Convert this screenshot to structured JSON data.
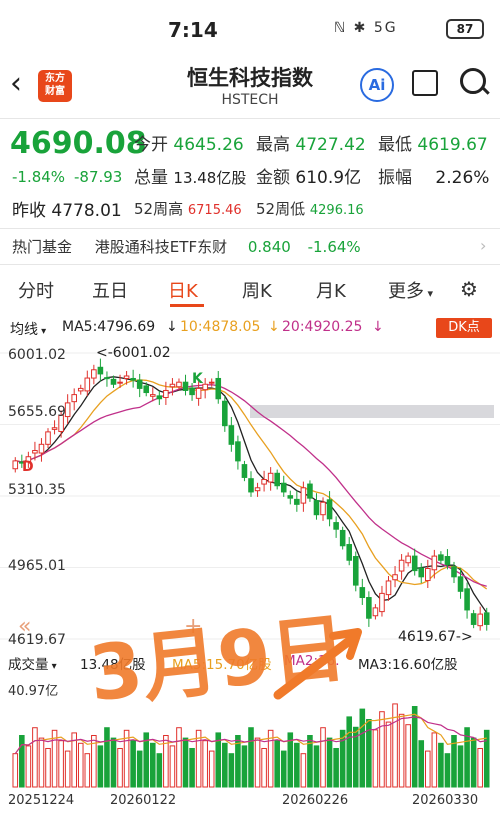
{
  "status_bar": {
    "time": "7:14",
    "battery": "87",
    "icons_text": "ℕ ✱ 5G"
  },
  "header": {
    "title": "恒生科技指数",
    "subtitle": "HSTECH",
    "logo_text": "东方\n财富",
    "ai_label": "Ai"
  },
  "quote": {
    "price": "4690.08",
    "change_pct": "-1.84%",
    "change_abs": "-87.93",
    "prev_close_label": "昨收",
    "prev_close": "4778.01",
    "open_label": "今开",
    "open": "4645.26",
    "high_label": "最高",
    "high": "4727.42",
    "low_label": "最低",
    "low": "4619.67",
    "volume_label": "总量",
    "volume": "13.48亿股",
    "amount_label": "金额",
    "amount": "610.9亿",
    "amplitude_label": "振幅",
    "amplitude": "2.26%",
    "wk52_high_label": "52周高",
    "wk52_high": "6715.46",
    "wk52_low_label": "52周低",
    "wk52_low": "4296.16"
  },
  "hot_fund": {
    "label": "热门基金",
    "name": "港股通科技ETF东财",
    "price": "0.840",
    "change": "-1.64%"
  },
  "tabs": [
    "分时",
    "五日",
    "日K",
    "周K",
    "月K",
    "更多"
  ],
  "active_tab": "日K",
  "ma_bar": {
    "label": "均线",
    "ma5": "MA5:4796.69",
    "ma10": "10:4878.05",
    "ma20": "20:4920.25",
    "dk": "DK点"
  },
  "chart_data": {
    "type": "candlestick",
    "y_ticks": [
      "6001.02",
      "5655.69",
      "5310.35",
      "4965.01",
      "4619.67"
    ],
    "ylim": [
      4619.67,
      6001.02
    ],
    "annotations": {
      "high": "<-6001.02",
      "low": "4619.67->",
      "k_mark": "K",
      "d_mark": "D"
    },
    "x_labels": [
      "20251224",
      "20260122",
      "20260226",
      "20260330"
    ],
    "colors": {
      "up": "#e0302b",
      "down": "#19a33a",
      "ma5": "#222222",
      "ma10": "#e8a020",
      "ma20": "#c0308a"
    },
    "closes": [
      5480,
      5470,
      5500,
      5530,
      5560,
      5620,
      5640,
      5700,
      5760,
      5800,
      5830,
      5880,
      5920,
      5900,
      5880,
      5850,
      5860,
      5890,
      5870,
      5830,
      5810,
      5800,
      5780,
      5820,
      5850,
      5860,
      5820,
      5800,
      5830,
      5850,
      5860,
      5780,
      5650,
      5560,
      5480,
      5400,
      5330,
      5350,
      5390,
      5420,
      5360,
      5330,
      5300,
      5270,
      5350,
      5300,
      5220,
      5280,
      5200,
      5150,
      5070,
      5000,
      4880,
      4820,
      4720,
      4770,
      4840,
      4900,
      4930,
      5000,
      5020,
      4950,
      4920,
      4960,
      5020,
      5000,
      4980,
      4920,
      4850,
      4760,
      4690,
      4740,
      4690
    ],
    "volume": {
      "label": "成交量",
      "value": "13.48亿股",
      "ma5": "MA5:15.70亿股",
      "ma2": "MA2:16.",
      "ma3": "MA3:16.60亿股",
      "max": "40.97亿"
    },
    "handwriting": "3月9日"
  }
}
